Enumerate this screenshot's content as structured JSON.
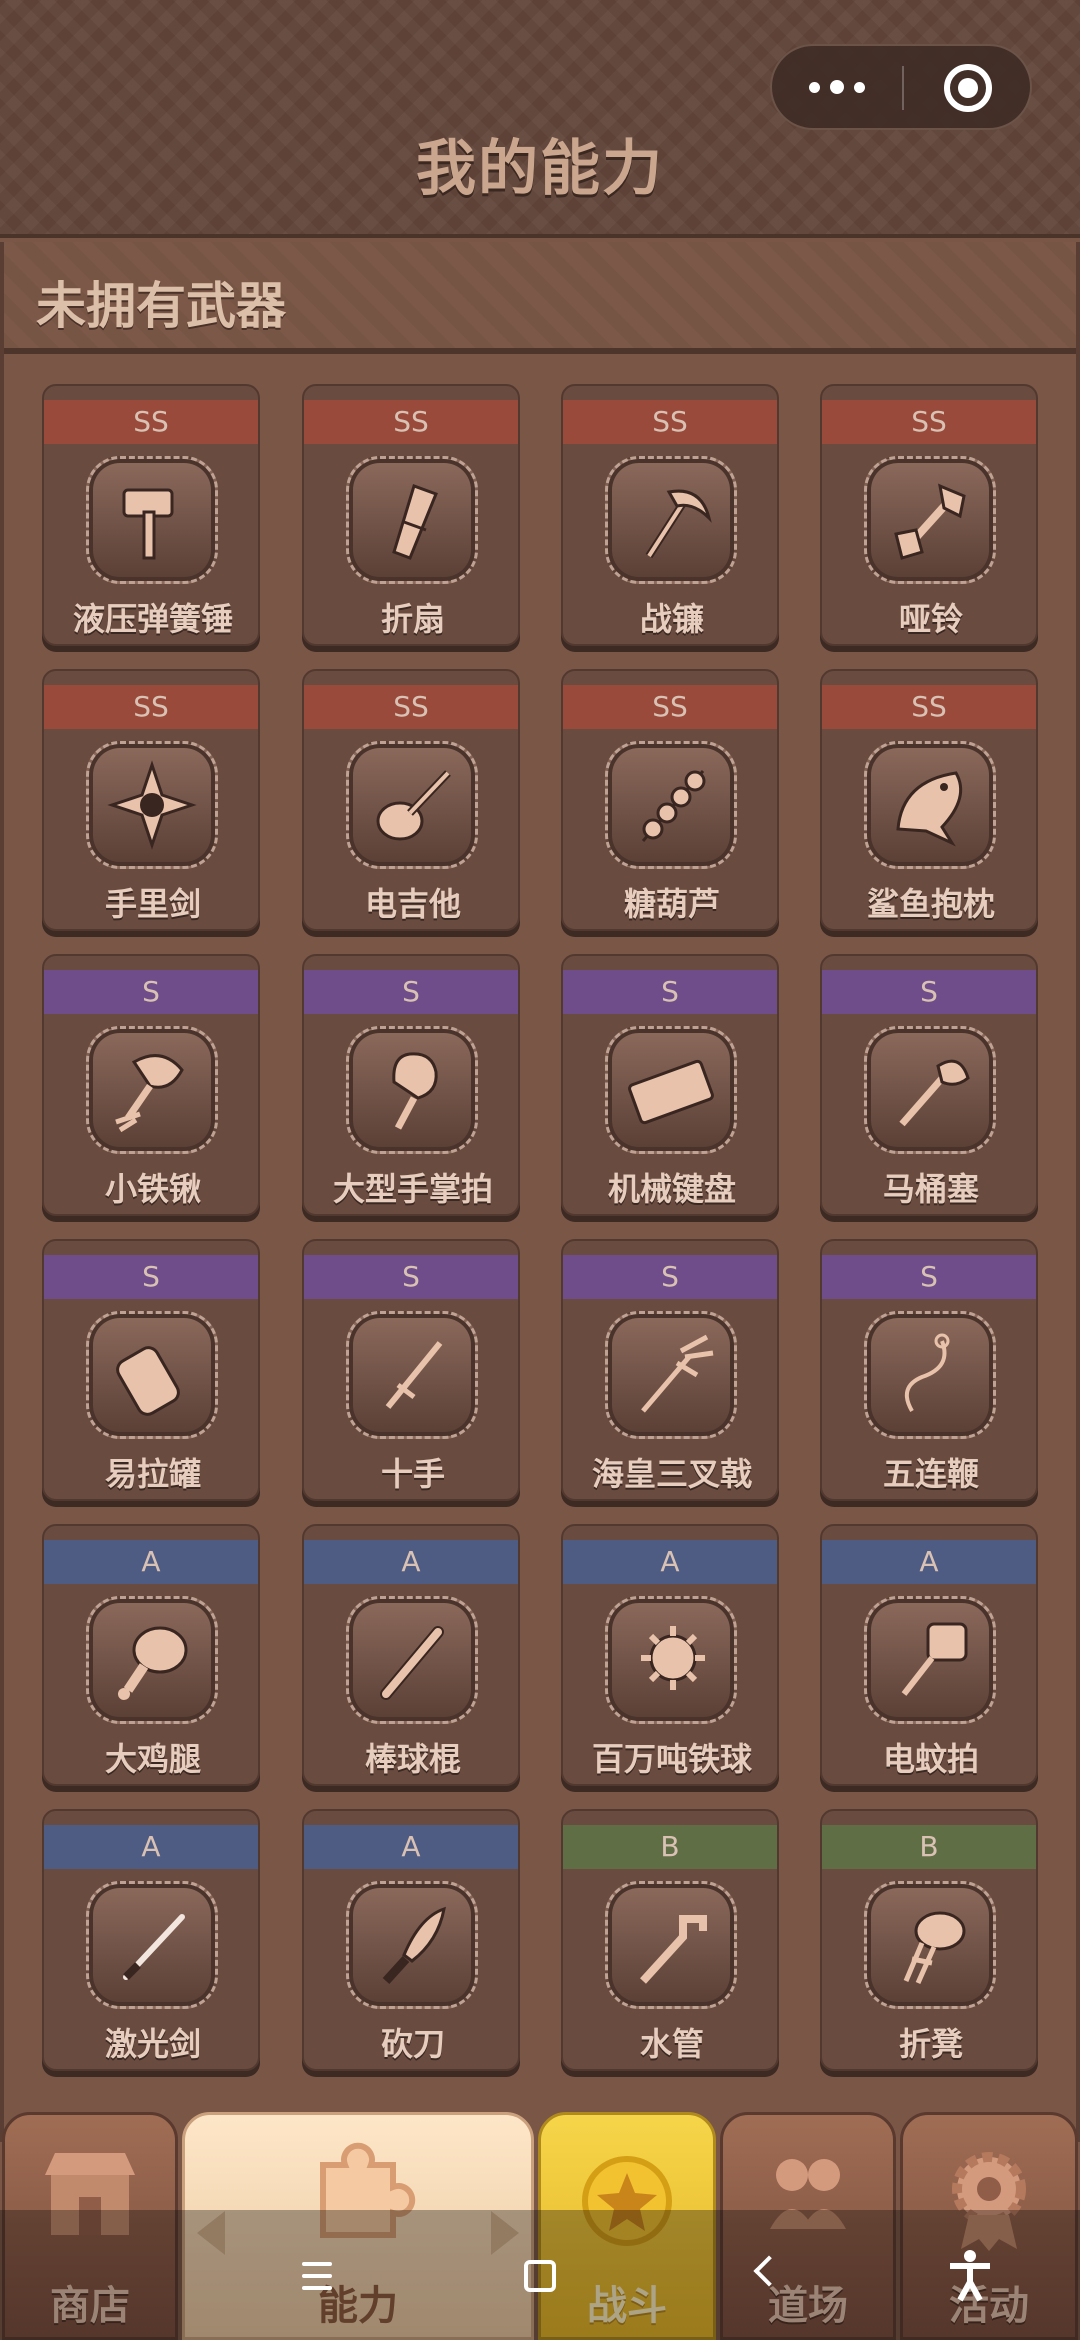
{
  "header": {
    "title": "我的能力"
  },
  "capsule": {
    "more_icon": "more-dots-icon",
    "close_icon": "target-icon"
  },
  "section": {
    "title": "未拥有武器"
  },
  "weapons": [
    {
      "rarity": "SS",
      "name": "液压弹簧锤",
      "icon": "hammer-icon"
    },
    {
      "rarity": "SS",
      "name": "折扇",
      "icon": "fan-icon"
    },
    {
      "rarity": "SS",
      "name": "战镰",
      "icon": "scythe-icon"
    },
    {
      "rarity": "SS",
      "name": "哑铃",
      "icon": "dumbbell-icon"
    },
    {
      "rarity": "SS",
      "name": "手里剑",
      "icon": "shuriken-icon"
    },
    {
      "rarity": "SS",
      "name": "电吉他",
      "icon": "guitar-icon"
    },
    {
      "rarity": "SS",
      "name": "糖葫芦",
      "icon": "candied-haws-icon"
    },
    {
      "rarity": "SS",
      "name": "鲨鱼抱枕",
      "icon": "shark-pillow-icon"
    },
    {
      "rarity": "S",
      "name": "小铁锹",
      "icon": "shovel-icon"
    },
    {
      "rarity": "S",
      "name": "大型手掌拍",
      "icon": "hand-clapper-icon"
    },
    {
      "rarity": "S",
      "name": "机械键盘",
      "icon": "keyboard-icon"
    },
    {
      "rarity": "S",
      "name": "马桶塞",
      "icon": "plunger-icon"
    },
    {
      "rarity": "S",
      "name": "易拉罐",
      "icon": "can-icon"
    },
    {
      "rarity": "S",
      "name": "十手",
      "icon": "jitte-icon"
    },
    {
      "rarity": "S",
      "name": "海皇三叉戟",
      "icon": "trident-icon"
    },
    {
      "rarity": "S",
      "name": "五连鞭",
      "icon": "whip-icon"
    },
    {
      "rarity": "A",
      "name": "大鸡腿",
      "icon": "drumstick-icon"
    },
    {
      "rarity": "A",
      "name": "棒球棍",
      "icon": "baseball-bat-icon"
    },
    {
      "rarity": "A",
      "name": "百万吨铁球",
      "icon": "spiked-ball-icon"
    },
    {
      "rarity": "A",
      "name": "电蚊拍",
      "icon": "swatter-icon"
    },
    {
      "rarity": "A",
      "name": "激光剑",
      "icon": "lightsaber-icon"
    },
    {
      "rarity": "A",
      "name": "砍刀",
      "icon": "machete-icon"
    },
    {
      "rarity": "B",
      "name": "水管",
      "icon": "pipe-icon"
    },
    {
      "rarity": "B",
      "name": "折凳",
      "icon": "stool-icon"
    }
  ],
  "tabs": [
    {
      "label": "商店",
      "icon": "shop-icon"
    },
    {
      "label": "能力",
      "icon": "puzzle-icon"
    },
    {
      "label": "战斗",
      "icon": "star-badge-icon"
    },
    {
      "label": "道场",
      "icon": "dojo-people-icon"
    },
    {
      "label": "活动",
      "icon": "gear-badge-icon"
    }
  ],
  "colors": {
    "ss": "#9a4a3a",
    "s": "#6e4d8a",
    "a": "#4e5c84",
    "b": "#5f6e45",
    "background": "#7a5646",
    "header": "#5e4237",
    "battle_tab": "#f6d54a"
  }
}
